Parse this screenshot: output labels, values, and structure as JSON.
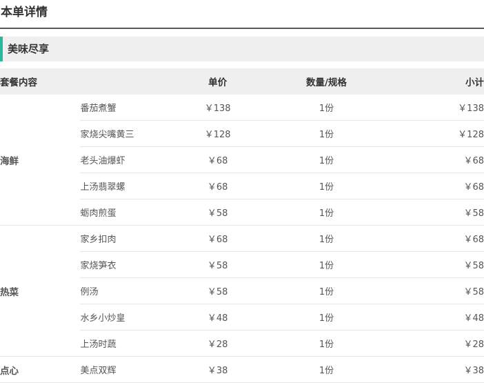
{
  "page": {
    "title": "本单详情",
    "section_title": "美味尽享"
  },
  "colors": {
    "accent": "#2ab99a",
    "header_bg": "#efefef",
    "title_rule": "#5a5a5a"
  },
  "table": {
    "headers": {
      "category": "套餐内容",
      "price": "单价",
      "qty": "数量/规格",
      "subtotal": "小计"
    },
    "groups": [
      {
        "category": "海鲜",
        "items": [
          {
            "name": "番茄煮蟹",
            "price": "￥138",
            "qty": "1份",
            "subtotal": "￥138"
          },
          {
            "name": "家烧尖嘴黄三",
            "price": "￥128",
            "qty": "1份",
            "subtotal": "￥128"
          },
          {
            "name": "老头油爆虾",
            "price": "￥68",
            "qty": "1份",
            "subtotal": "￥68"
          },
          {
            "name": "上汤翡翠螺",
            "price": "￥68",
            "qty": "1份",
            "subtotal": "￥68"
          },
          {
            "name": "蛎肉煎蛋",
            "price": "￥58",
            "qty": "1份",
            "subtotal": "￥58"
          }
        ]
      },
      {
        "category": "热菜",
        "items": [
          {
            "name": "家乡扣肉",
            "price": "￥68",
            "qty": "1份",
            "subtotal": "￥68"
          },
          {
            "name": "家烧笋衣",
            "price": "￥58",
            "qty": "1份",
            "subtotal": "￥58"
          },
          {
            "name": "例汤",
            "price": "￥58",
            "qty": "1份",
            "subtotal": "￥58"
          },
          {
            "name": "水乡小炒皇",
            "price": "￥48",
            "qty": "1份",
            "subtotal": "￥48"
          },
          {
            "name": "上汤时蔬",
            "price": "￥28",
            "qty": "1份",
            "subtotal": "￥28"
          }
        ]
      },
      {
        "category": "点心",
        "items": [
          {
            "name": "美点双辉",
            "price": "￥38",
            "qty": "1份",
            "subtotal": "￥38"
          }
        ]
      }
    ]
  }
}
